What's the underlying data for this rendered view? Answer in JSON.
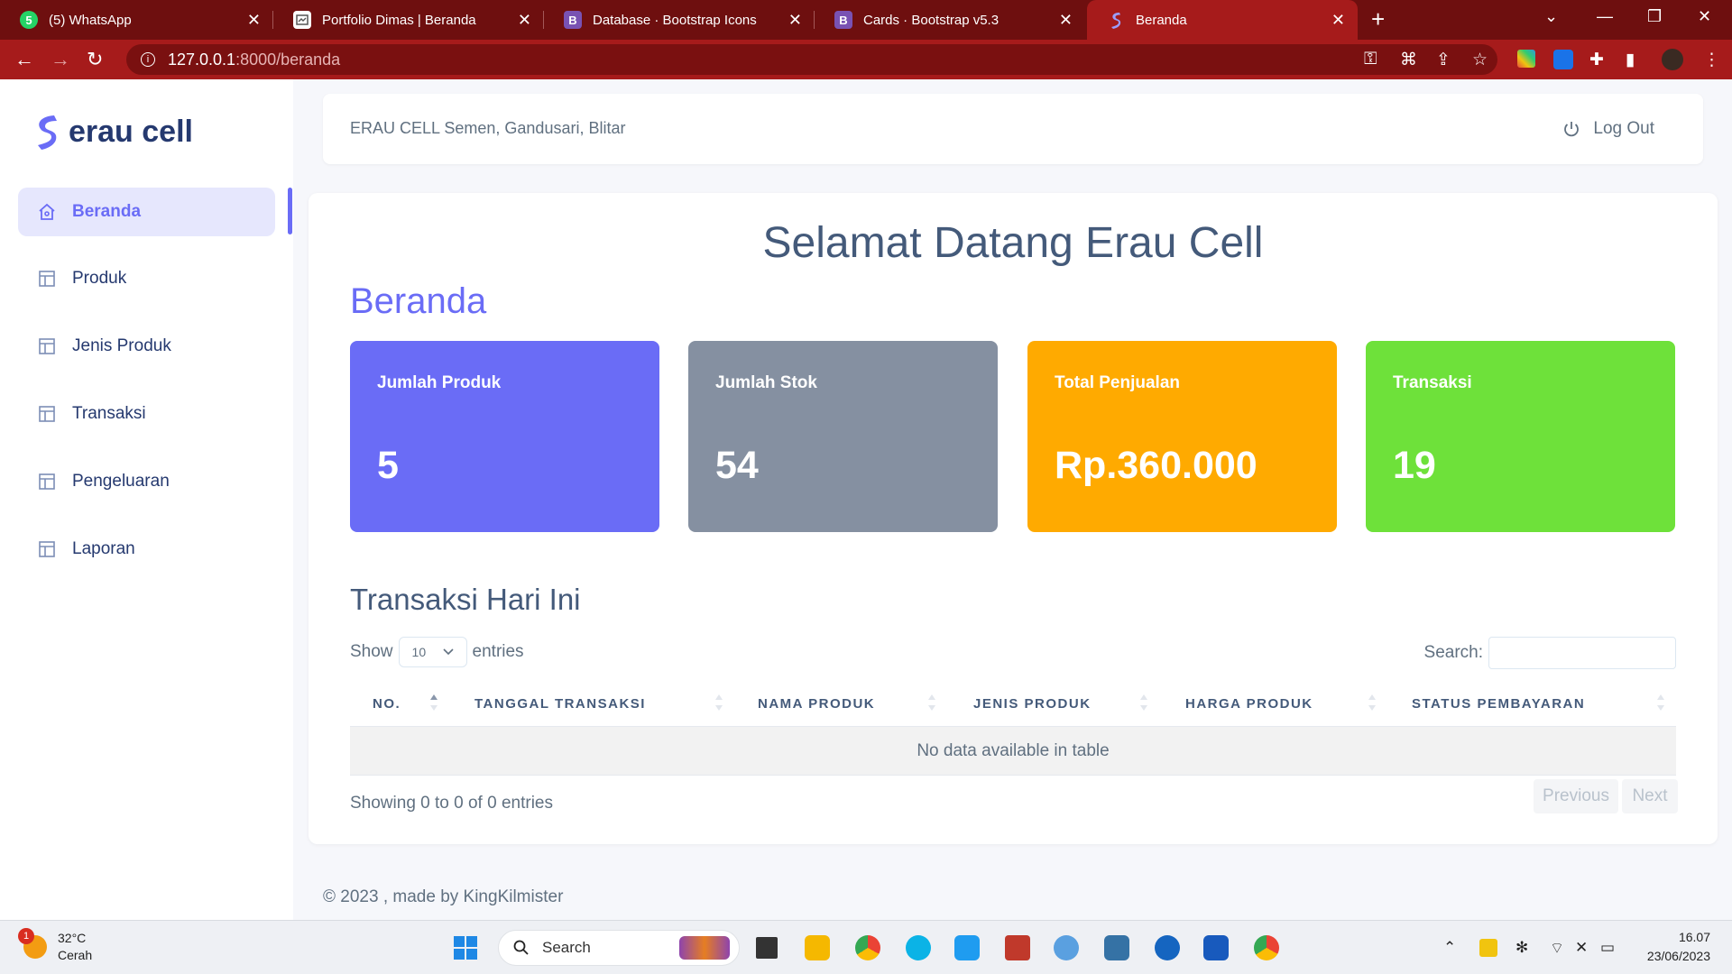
{
  "browser": {
    "tabs": [
      {
        "title": "(5) WhatsApp",
        "icon": "whatsapp-icon",
        "color": "#25d366",
        "glyph": "5"
      },
      {
        "title": "Portfolio Dimas | Beranda",
        "icon": "page-icon",
        "color": "#ffffff",
        "glyph": ""
      },
      {
        "title": "Database · Bootstrap Icons",
        "icon": "bootstrap-icon",
        "color": "#7952b3",
        "glyph": "B"
      },
      {
        "title": "Cards · Bootstrap v5.3",
        "icon": "bootstrap-icon",
        "color": "#7952b3",
        "glyph": "B"
      },
      {
        "title": "Beranda",
        "icon": "mazer-icon",
        "color": "#6a6cf6",
        "glyph": "S"
      }
    ],
    "url_host": "127.0.0.1",
    "url_path": ":8000/beranda"
  },
  "sidebar": {
    "brand": "erau cell",
    "items": [
      {
        "label": "Beranda",
        "icon": "house-icon"
      },
      {
        "label": "Produk",
        "icon": "grid-icon"
      },
      {
        "label": "Jenis Produk",
        "icon": "grid-icon"
      },
      {
        "label": "Transaksi",
        "icon": "grid-icon"
      },
      {
        "label": "Pengeluaran",
        "icon": "grid-icon"
      },
      {
        "label": "Laporan",
        "icon": "grid-icon"
      }
    ]
  },
  "header": {
    "location": "ERAU CELL Semen, Gandusari, Blitar",
    "logout": "Log Out"
  },
  "main": {
    "welcome": "Selamat Datang Erau Cell",
    "page_title": "Beranda",
    "stats": [
      {
        "label": "Jumlah Produk",
        "value": "5",
        "color": "#6a6cf6"
      },
      {
        "label": "Jumlah Stok",
        "value": "54",
        "color": "#8590a1"
      },
      {
        "label": "Total Penjualan",
        "value": "Rp.360.000",
        "color": "#ffaa00"
      },
      {
        "label": "Transaksi",
        "value": "19",
        "color": "#6ee13a"
      }
    ],
    "section_title": "Transaksi Hari Ini",
    "table": {
      "show_label": "Show",
      "entries_value": "10",
      "entries_label": "entries",
      "search_label": "Search:",
      "columns": [
        "NO.",
        "TANGGAL TRANSAKSI",
        "NAMA PRODUK",
        "JENIS PRODUK",
        "HARGA PRODUK",
        "STATUS PEMBAYARAN"
      ],
      "empty_text": "No data available in table",
      "info": "Showing 0 to 0 of 0 entries",
      "prev": "Previous",
      "next": "Next"
    }
  },
  "footer": {
    "text": "© 2023 , made by KingKilmister"
  },
  "taskbar": {
    "temp": "32°C",
    "condition": "Cerah",
    "weather_badge": "1",
    "search": "Search",
    "time": "16.07",
    "date": "23/06/2023"
  }
}
